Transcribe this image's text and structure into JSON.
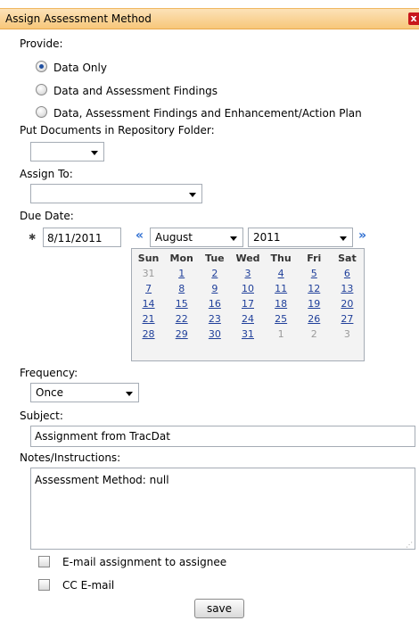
{
  "window": {
    "title": "Assign Assessment Method",
    "close_glyph": "x"
  },
  "provide": {
    "label": "Provide:",
    "options": [
      {
        "label": "Data Only",
        "checked": true
      },
      {
        "label": "Data and Assessment Findings",
        "checked": false
      },
      {
        "label": "Data, Assessment Findings and Enhancement/Action Plan",
        "checked": false
      }
    ]
  },
  "repository": {
    "label": "Put Documents in Repository Folder:",
    "value": ""
  },
  "assign_to": {
    "label": "Assign To:",
    "value": ""
  },
  "due_date": {
    "label": "Due Date:",
    "value": "8/11/2011",
    "month": "August",
    "year": "2011",
    "prev_glyph": "«",
    "next_glyph": "»",
    "weekdays": [
      "Sun",
      "Mon",
      "Tue",
      "Wed",
      "Thu",
      "Fri",
      "Sat"
    ],
    "weeks": [
      [
        "31",
        "1",
        "2",
        "3",
        "4",
        "5",
        "6"
      ],
      [
        "7",
        "8",
        "9",
        "10",
        "11",
        "12",
        "13"
      ],
      [
        "14",
        "15",
        "16",
        "17",
        "18",
        "19",
        "20"
      ],
      [
        "21",
        "22",
        "23",
        "24",
        "25",
        "26",
        "27"
      ],
      [
        "28",
        "29",
        "30",
        "31",
        "1",
        "2",
        "3"
      ]
    ]
  },
  "frequency": {
    "label": "Frequency:",
    "value": "Once"
  },
  "subject": {
    "label": "Subject:",
    "value": "Assignment from TracDat"
  },
  "notes": {
    "label": "Notes/Instructions:",
    "value": "Assessment Method: null"
  },
  "email_assignee": {
    "label": "E-mail assignment to assignee",
    "checked": false
  },
  "cc_email": {
    "label": "CC E-mail",
    "checked": false
  },
  "save_label": "save"
}
